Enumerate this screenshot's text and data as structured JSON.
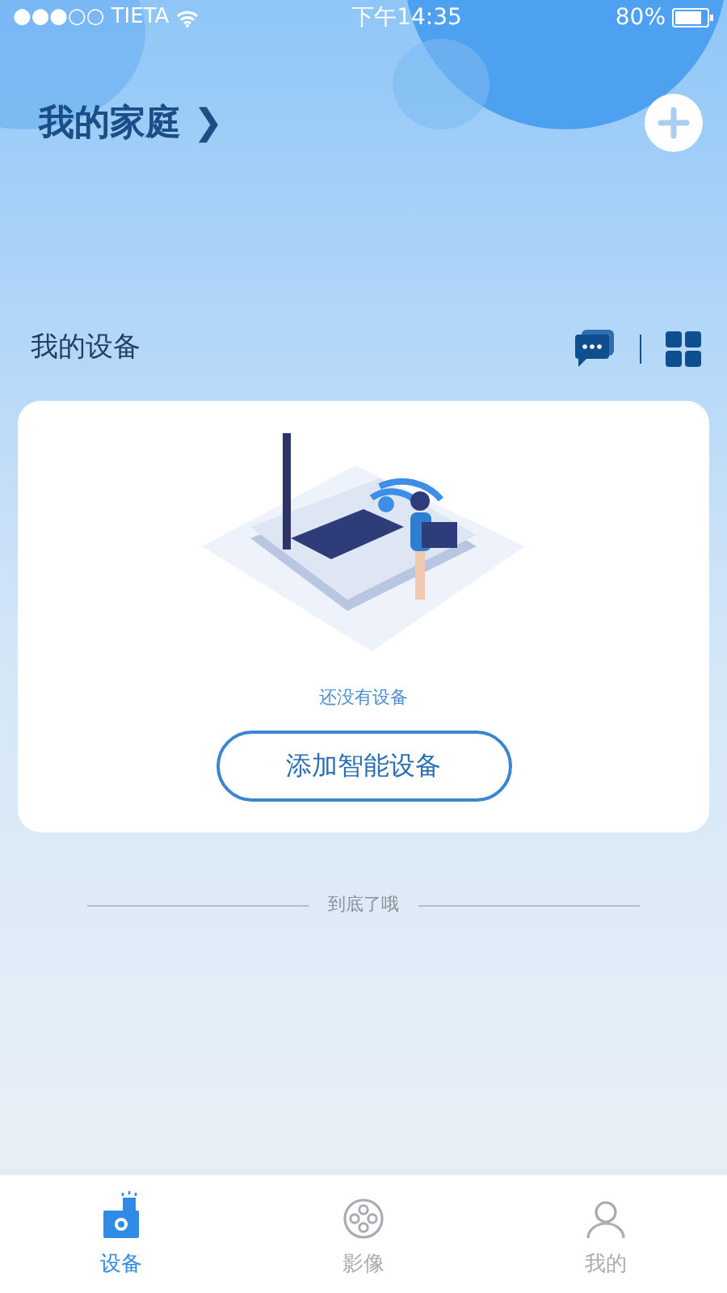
{
  "status_bar": {
    "carrier": "●●●○○ TIETA",
    "time": "下午14:35",
    "battery": "80%"
  },
  "header": {
    "title": "我的家庭",
    "chevron": "❯"
  },
  "section": {
    "title": "我的设备"
  },
  "empty_state": {
    "message": "还没有设备",
    "button": "添加智能设备"
  },
  "footer_note": "到底了哦",
  "tabs": [
    {
      "kind": "devices",
      "label": "设备",
      "selected": true
    },
    {
      "kind": "media",
      "label": "影像",
      "selected": false
    },
    {
      "kind": "profile",
      "label": "我的",
      "selected": false
    }
  ]
}
